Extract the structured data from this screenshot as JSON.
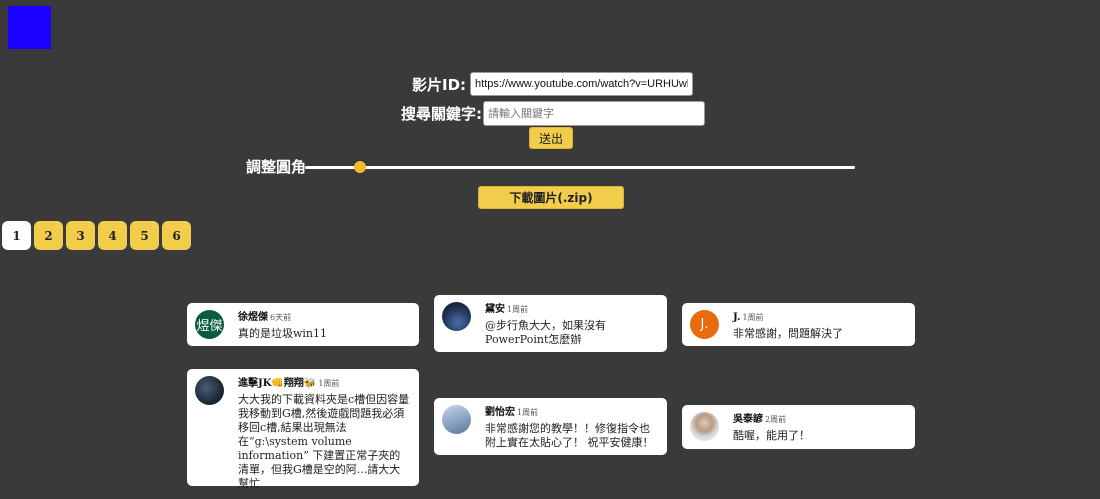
{
  "form": {
    "video_id_label": "影片ID:",
    "video_id_value": "https://www.youtube.com/watch?v=URHUwlIO_GA",
    "keyword_label": "搜尋關鍵字:",
    "keyword_placeholder": "請輸入關鍵字",
    "submit_label": "送出",
    "corner_label": "調整圓角",
    "corner_radius_fraction": 0.1,
    "download_label": "下載圖片(.zip)"
  },
  "pagination": {
    "pages": [
      "1",
      "2",
      "3",
      "4",
      "5",
      "6"
    ],
    "active": "1"
  },
  "comments": [
    {
      "author": "徐煜傑",
      "time": "6天前",
      "text": "真的是垃圾win11",
      "avatar_text": "煜傑",
      "avatar_color": "#0b5a43"
    },
    {
      "author": "黛安",
      "time": "1周前",
      "text": "@步行魚大大，如果沒有PowerPoint怎麼辦",
      "avatar_text": "",
      "avatar_color": "#2a3f66"
    },
    {
      "author": "J.",
      "time": "1周前",
      "text": "非常感謝，問題解決了",
      "avatar_text": "J.",
      "avatar_color": "#ea6a0e"
    },
    {
      "author": "進擊JK👊翔翔🐝",
      "time": "1周前",
      "text": "大大我的下載資料夾是c槽但因容量我移動到G槽,然後遊戲問題我必須移回c槽,結果出現無法在“g:\\system volume information” 下建置正常子夾的清單，但我G槽是空的阿...請大大幫忙",
      "avatar_text": "",
      "avatar_color": "#1d2a3a"
    },
    {
      "author": "劉怡宏",
      "time": "1周前",
      "text": "非常感謝您的教學！！修復指令也附上實在太貼心了！ 祝平安健康！",
      "avatar_text": "",
      "avatar_color": "#8fa6c4"
    },
    {
      "author": "吳泰諺",
      "time": "2周前",
      "text": "酷喔，能用了！",
      "avatar_text": "",
      "avatar_color": "#bfbfbf"
    }
  ],
  "colors": {
    "background": "#3a3a3a",
    "accent": "#f1cd4b",
    "logo": "#1a00ff"
  }
}
